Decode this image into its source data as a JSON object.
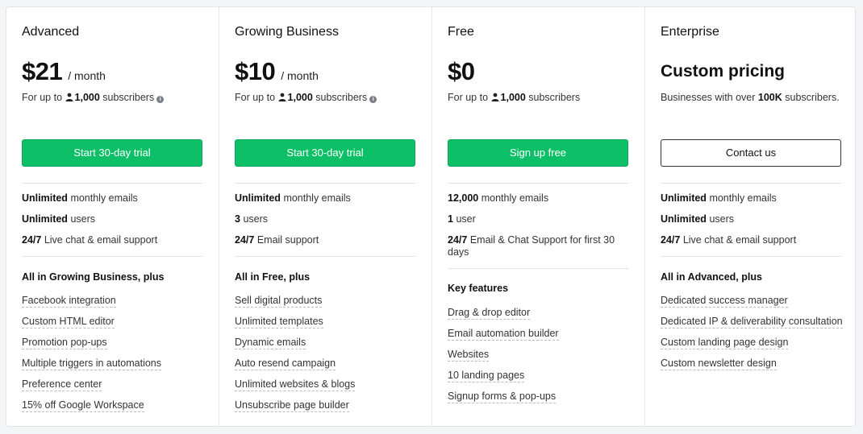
{
  "plans": [
    {
      "name": "Advanced",
      "price": "$21",
      "per": "/ month",
      "sub_prefix": "For up to",
      "sub_count": "1,000",
      "sub_suffix": "subscribers",
      "cta": "Start 30-day trial",
      "stats": [
        {
          "bold": "Unlimited",
          "text": "monthly emails"
        },
        {
          "bold": "Unlimited",
          "text": "users"
        },
        {
          "bold": "24/7",
          "text": "Live chat & email support"
        }
      ],
      "features_heading": "All in Growing Business, plus",
      "features": [
        "Facebook integration",
        "Custom HTML editor",
        "Promotion pop-ups",
        "Multiple triggers in automations",
        "Preference center",
        "15% off Google Workspace"
      ]
    },
    {
      "name": "Growing Business",
      "price": "$10",
      "per": "/ month",
      "sub_prefix": "For up to",
      "sub_count": "1,000",
      "sub_suffix": "subscribers",
      "cta": "Start 30-day trial",
      "stats": [
        {
          "bold": "Unlimited",
          "text": "monthly emails"
        },
        {
          "bold": "3",
          "text": "users"
        },
        {
          "bold": "24/7",
          "text": "Email support"
        }
      ],
      "features_heading": "All in Free, plus",
      "features": [
        "Sell digital products",
        "Unlimited templates",
        "Dynamic emails",
        "Auto resend campaign",
        "Unlimited websites & blogs",
        "Unsubscribe page builder"
      ]
    },
    {
      "name": "Free",
      "price": "$0",
      "sub_prefix": "For up to",
      "sub_count": "1,000",
      "sub_suffix": "subscribers",
      "cta": "Sign up free",
      "stats": [
        {
          "bold": "12,000",
          "text": "monthly emails"
        },
        {
          "bold": "1",
          "text": "user"
        },
        {
          "bold": "24/7",
          "text": "Email & Chat Support for first 30 days"
        }
      ],
      "features_heading": "Key features",
      "features": [
        "Drag & drop editor",
        "Email automation builder",
        "Websites",
        "10 landing pages",
        "Signup forms & pop-ups"
      ]
    },
    {
      "name": "Enterprise",
      "custom_price": "Custom pricing",
      "sub_prefix": "Businesses with over",
      "sub_count": "100K",
      "sub_suffix": "subscribers.",
      "cta": "Contact us",
      "stats": [
        {
          "bold": "Unlimited",
          "text": "monthly emails"
        },
        {
          "bold": "Unlimited",
          "text": "users"
        },
        {
          "bold": "24/7",
          "text": "Live chat & email support"
        }
      ],
      "features_heading": "All in Advanced, plus",
      "features": [
        "Dedicated success manager",
        "Dedicated IP & deliverability consultation",
        "Custom landing page design",
        "Custom newsletter design"
      ]
    }
  ],
  "icons": {
    "user": "user-icon",
    "info": "info-icon"
  },
  "colors": {
    "accent": "#0dbf67",
    "outline_border": "#333333"
  }
}
